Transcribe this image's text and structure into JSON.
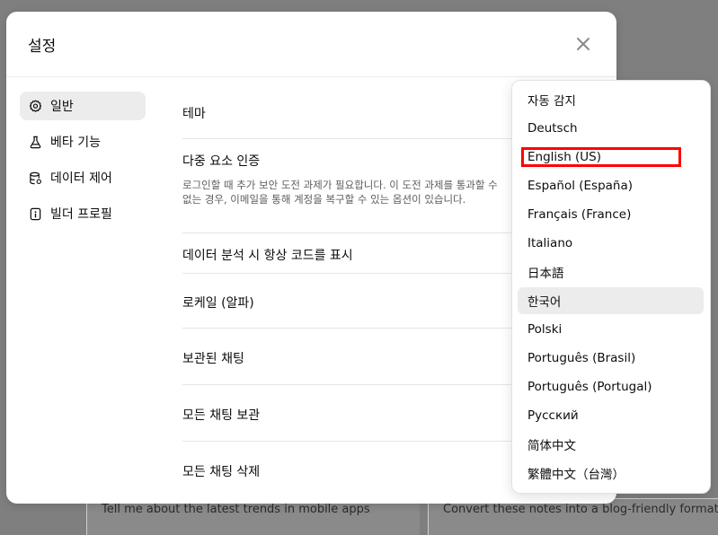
{
  "backdrop": {
    "left_text": "Tell me about the latest trends in mobile apps",
    "right_text": "Convert these notes into a blog-friendly format"
  },
  "modal": {
    "title": "설정",
    "close_icon": "close-icon"
  },
  "sidebar": {
    "items": [
      {
        "label": "일반",
        "icon": "gear-icon",
        "active": true
      },
      {
        "label": "베타 기능",
        "icon": "flask-icon",
        "active": false
      },
      {
        "label": "데이터 제어",
        "icon": "database-icon",
        "active": false
      },
      {
        "label": "빌더 프로필",
        "icon": "id-card-icon",
        "active": false
      }
    ]
  },
  "settings": {
    "theme": "테마",
    "mfa_title": "다중 요소 인증",
    "mfa_desc": "로그인할 때 추가 보안 도전 과제가 필요합니다. 이 도전 과제를 통과할 수 없는 경우, 이메일을 통해 계정을 복구할 수 있는 옵션이 있습니다.",
    "always_show_code": "데이터 분석 시 항상 코드를 표시",
    "locale": "로케일 (알파)",
    "archived_chats": "보관된 채팅",
    "archive_all": "모든 채팅 보관",
    "delete_all": "모든 채팅 삭제"
  },
  "locale_dropdown": {
    "options": [
      "자동 감지",
      "Deutsch",
      "English (US)",
      "Español (España)",
      "Français (France)",
      "Italiano",
      "日本語",
      "한국어",
      "Polski",
      "Português (Brasil)",
      "Português (Portugal)",
      "Русский",
      "简体中文",
      "繁體中文（台灣）"
    ],
    "selected": "한국어",
    "highlighted": "English (US)"
  },
  "colors": {
    "overlay": "#7f7f7f",
    "highlight": "#ff0000",
    "selected_bg": "#ececec"
  }
}
